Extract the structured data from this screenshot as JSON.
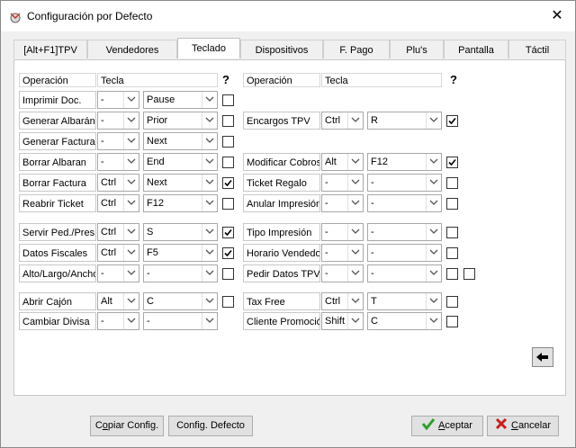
{
  "window": {
    "title": "Configuración por Defecto",
    "close_glyph": "✕"
  },
  "tabs": [
    {
      "label": "[Alt+F1]TPV"
    },
    {
      "label": "Vendedores"
    },
    {
      "label": "Teclado"
    },
    {
      "label": "Dispositivos"
    },
    {
      "label": "F. Pago"
    },
    {
      "label": "Plu's"
    },
    {
      "label": "Pantalla"
    },
    {
      "label": "Táctil"
    }
  ],
  "headers": {
    "operacion": "Operación",
    "tecla": "Tecla",
    "help_glyph": "?"
  },
  "left": [
    {
      "label": "Imprimir Doc.",
      "mod": "-",
      "key": "Pause",
      "checked": false
    },
    {
      "label": "Generar Albarán",
      "mod": "-",
      "key": "Prior",
      "checked": false
    },
    {
      "label": "Generar Factura",
      "mod": "-",
      "key": "Next",
      "checked": false
    },
    {
      "label": "Borrar Albaran",
      "mod": "-",
      "key": "End",
      "checked": false
    },
    {
      "label": "Borrar Factura",
      "mod": "Ctrl",
      "key": "Next",
      "checked": true
    },
    {
      "label": "Reabrir Ticket",
      "mod": "Ctrl",
      "key": "F12",
      "checked": false
    },
    {
      "label": "Servir Ped./Pres.",
      "mod": "Ctrl",
      "key": "S",
      "checked": true
    },
    {
      "label": "Datos Fiscales",
      "mod": "Ctrl",
      "key": "F5",
      "checked": true
    },
    {
      "label": "Alto/Largo/Ancho",
      "mod": "-",
      "key": "-",
      "checked": false
    },
    {
      "label": "Abrir Cajón",
      "mod": "Alt",
      "key": "C",
      "checked": false
    },
    {
      "label": "Cambiar Divisa",
      "mod": "-",
      "key": "-"
    }
  ],
  "right": [
    {
      "label": "Encargos TPV",
      "mod": "Ctrl",
      "key": "R",
      "checked": true
    },
    {
      "label": "Modificar Cobros",
      "mod": "Alt",
      "key": "F12",
      "checked": true
    },
    {
      "label": "Ticket Regalo",
      "mod": "-",
      "key": "-",
      "checked": false
    },
    {
      "label": "Anular Impresión",
      "mod": "-",
      "key": "-",
      "checked": false
    },
    {
      "label": "Tipo Impresión",
      "mod": "-",
      "key": "-",
      "checked": false
    },
    {
      "label": "Horario Vendedor",
      "mod": "-",
      "key": "-",
      "checked": false
    },
    {
      "label": "Pedir Datos TPV",
      "mod": "-",
      "key": "-",
      "checked": false,
      "checked2": false
    },
    {
      "label": "Tax Free",
      "mod": "Ctrl",
      "key": "T",
      "checked": false
    },
    {
      "label": "Cliente Promoción",
      "mod": "Shift",
      "key": "C",
      "checked": false
    }
  ],
  "buttons": {
    "copiar": {
      "pre": "C",
      "u": "o",
      "post": "piar Config."
    },
    "defecto": {
      "label": "Config. Defecto"
    },
    "aceptar": {
      "u": "A",
      "post": "ceptar"
    },
    "cancelar": {
      "u": "C",
      "post": "ancelar"
    }
  },
  "colors": {
    "accept_check": "#2e9e2e",
    "cancel_x": "#c81e1e"
  }
}
